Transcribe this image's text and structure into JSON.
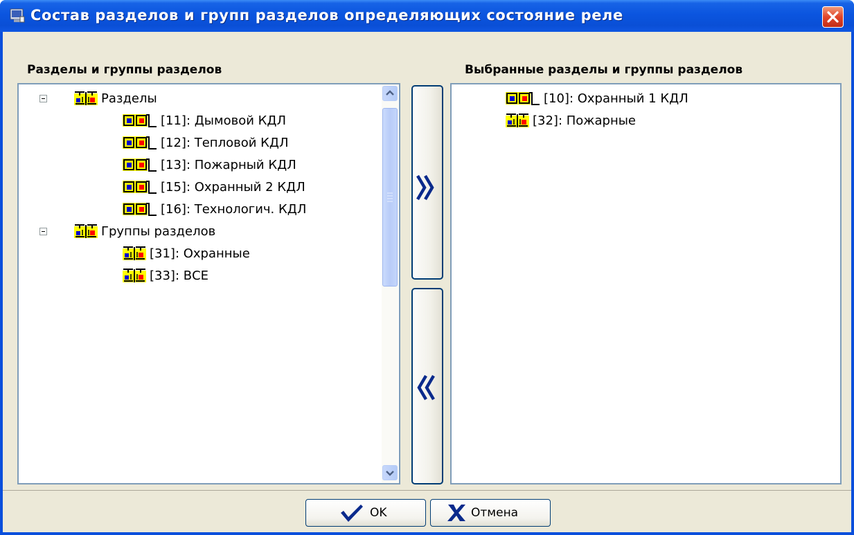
{
  "window": {
    "title": "Состав разделов и групп разделов определяющих состояние реле"
  },
  "left_panel": {
    "header": "Разделы и группы разделов",
    "tree": [
      {
        "label": "Разделы",
        "level": 0,
        "icon": "section-group-icon",
        "expanded": true
      },
      {
        "label": "[11]: Дымовой КДЛ",
        "level": 1,
        "icon": "section-icon"
      },
      {
        "label": "[12]: Тепловой КДЛ",
        "level": 1,
        "icon": "section-icon"
      },
      {
        "label": "[13]: Пожарный КДЛ",
        "level": 1,
        "icon": "section-icon"
      },
      {
        "label": "[15]: Охранный 2 КДЛ",
        "level": 1,
        "icon": "section-icon"
      },
      {
        "label": "[16]: Технологич. КДЛ",
        "level": 1,
        "icon": "section-icon"
      },
      {
        "label": "Группы разделов",
        "level": 0,
        "icon": "section-group-icon",
        "expanded": true
      },
      {
        "label": "[31]: Охранные",
        "level": 1,
        "icon": "section-group-icon"
      },
      {
        "label": "[33]: ВСЕ",
        "level": 1,
        "icon": "section-group-icon"
      }
    ]
  },
  "right_panel": {
    "header": "Выбранные разделы и группы разделов",
    "tree": [
      {
        "label": "[10]: Охранный 1 КДЛ",
        "icon": "section-icon"
      },
      {
        "label": "[32]: Пожарные",
        "icon": "section-group-icon"
      }
    ]
  },
  "buttons": {
    "add_glyph": "»",
    "remove_glyph": "«",
    "ok_label": "OK",
    "cancel_label": "Отмена"
  },
  "colors": {
    "titlebar": "#0a4fdc",
    "icon_yellow": "#ffff00",
    "icon_red": "#ff0000",
    "icon_blue": "#0000cc",
    "arrow_blue": "#0a2a8c"
  }
}
